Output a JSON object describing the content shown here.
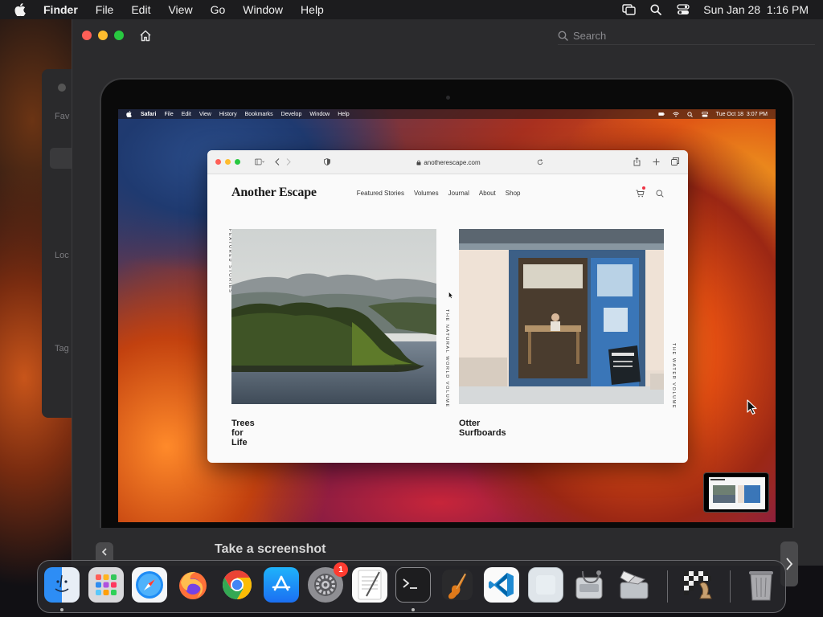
{
  "menubar": {
    "app": "Finder",
    "items": [
      "File",
      "Edit",
      "View",
      "Go",
      "Window",
      "Help"
    ],
    "datetime": "Sun Jan 28  1:16 PM"
  },
  "quicklook": {
    "search_placeholder": "Search",
    "caption": "Take a screenshot"
  },
  "finder_sidebar": {
    "labels": [
      "Fav",
      "Loc",
      "Tag"
    ]
  },
  "inner_menubar": {
    "app": "Safari",
    "items": [
      "File",
      "Edit",
      "View",
      "History",
      "Bookmarks",
      "Develop",
      "Window",
      "Help"
    ],
    "datetime": "Tue Oct 18  3:07 PM"
  },
  "safari": {
    "url": "anotherescape.com",
    "site": {
      "logo": "Another Escape",
      "nav": [
        "Featured Stories",
        "Volumes",
        "Journal",
        "About",
        "Shop"
      ],
      "section_label": "FEATURED STORIES",
      "stories": [
        {
          "title": "Trees for Life",
          "volume": "THE NATURAL WORLD VOLUME"
        },
        {
          "title": "Otter Surfboards",
          "volume": "THE WATER VOLUME"
        }
      ]
    }
  },
  "dock": {
    "apps": [
      "Finder",
      "Launchpad",
      "Safari",
      "Firefox",
      "Chrome",
      "App Store",
      "System Settings",
      "TextEdit",
      "Terminal",
      "GarageBand",
      "Visual Studio Code",
      "Preview",
      "Disk Utility",
      "Boot Camp Assistant",
      "Chess",
      "Trash"
    ],
    "settings_badge": "1"
  },
  "colors": {
    "red": "#ff5f57",
    "yellow": "#febc2e",
    "green": "#28c840",
    "badge": "#ff3b30"
  }
}
